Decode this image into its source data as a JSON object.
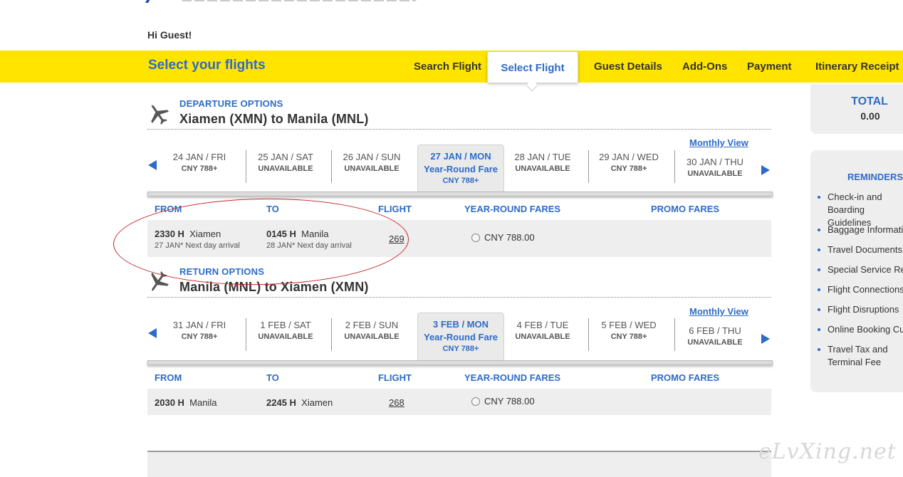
{
  "header": {
    "greeting": "Hi Guest!"
  },
  "nav": {
    "title": "Select your flights",
    "steps": [
      "Search Flight",
      "Select Flight",
      "Guest Details",
      "Add-Ons",
      "Payment",
      "Itinerary Receipt"
    ],
    "active_step": "Select Flight"
  },
  "sidebar": {
    "total_label": "TOTAL",
    "total_value": "0.00",
    "reminders_title": "REMINDERS",
    "reminders": [
      "Check-in and Boarding Guidelines",
      "Baggage Information",
      "Travel Documents",
      "Special Service Requests",
      "Flight Connections",
      "Flight Disruptions",
      "Online Booking Cutoff",
      "Travel Tax and Terminal Fee"
    ]
  },
  "departure": {
    "label": "DEPARTURE OPTIONS",
    "route": "Xiamen (XMN) to Manila (MNL)",
    "monthly_view": "Monthly View",
    "dates": [
      {
        "date": "24 JAN / FRI",
        "price": "CNY 788+"
      },
      {
        "date": "25 JAN / SAT",
        "price": "UNAVAILABLE"
      },
      {
        "date": "26 JAN / SUN",
        "price": "UNAVAILABLE"
      },
      {
        "date": "27 JAN / MON",
        "fare": "Year-Round Fare",
        "price": "CNY  788+"
      },
      {
        "date": "28 JAN / TUE",
        "price": "UNAVAILABLE"
      },
      {
        "date": "29 JAN / WED",
        "price": "CNY 788+"
      },
      {
        "date": "30 JAN / THU",
        "price": "UNAVAILABLE"
      }
    ],
    "columns": [
      "FROM",
      "TO",
      "FLIGHT",
      "YEAR-ROUND FARES",
      "PROMO FARES"
    ],
    "flight": {
      "dep_time": "2330 H",
      "dep_city": "Xiamen",
      "dep_sub": "27 JAN*  Next day arrival",
      "arr_time": "0145 H",
      "arr_city": "Manila",
      "arr_sub": "28 JAN*  Next day arrival",
      "number": "269",
      "fare": "CNY  788.00"
    }
  },
  "return": {
    "label": "RETURN OPTIONS",
    "route": "Manila (MNL) to Xiamen (XMN)",
    "monthly_view": "Monthly View",
    "dates": [
      {
        "date": "31 JAN / FRI",
        "price": "CNY 788+"
      },
      {
        "date": "1 FEB / SAT",
        "price": "UNAVAILABLE"
      },
      {
        "date": "2 FEB / SUN",
        "price": "UNAVAILABLE"
      },
      {
        "date": "3 FEB / MON",
        "fare": "Year-Round Fare",
        "price": "CNY  788+"
      },
      {
        "date": "4 FEB / TUE",
        "price": "UNAVAILABLE"
      },
      {
        "date": "5 FEB / WED",
        "price": "CNY 788+"
      },
      {
        "date": "6 FEB / THU",
        "price": "UNAVAILABLE"
      }
    ],
    "columns": [
      "FROM",
      "TO",
      "FLIGHT",
      "YEAR-ROUND FARES",
      "PROMO FARES"
    ],
    "flight": {
      "dep_time": "2030 H",
      "dep_city": "Manila",
      "arr_time": "2245 H",
      "arr_city": "Xiamen",
      "number": "268",
      "fare": "CNY  788.00"
    }
  },
  "watermark": "eLvXing.net",
  "colors": {
    "accent": "#2d6bc9",
    "bar": "#ffe400",
    "annotation": "#c2272d"
  }
}
